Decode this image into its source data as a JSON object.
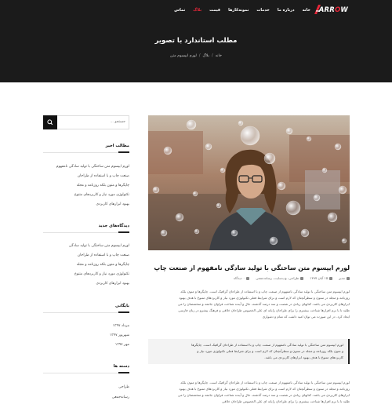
{
  "header": {
    "logo": {
      "main": "ARR",
      "accent": "O",
      "end": "W"
    },
    "nav": [
      {
        "label": "خانه",
        "active": false
      },
      {
        "label": "درباره ما",
        "active": false
      },
      {
        "label": "خدمات",
        "active": false
      },
      {
        "label": "نمونه‌کارها",
        "active": false
      },
      {
        "label": "قیمت",
        "active": false
      },
      {
        "label": "بلاگ",
        "active": true
      },
      {
        "label": "تماس",
        "active": false
      }
    ],
    "page_title": "مطلب استاندارد با تصویر",
    "breadcrumb": [
      "خانه",
      "بلاگ",
      "لورم ایپسوم متن"
    ]
  },
  "sidebar": {
    "search_placeholder": "جستجو ...",
    "recent_posts_title": "مطالب اخیر",
    "recent_posts": [
      "لورم ایپسوم متن ساختگی با تولید سادگی نامفهوم",
      "صنعت چاپ و با استفاده از طراحان",
      "چاپگرها و متون بلکه روزنامه و مجله",
      "تکنولوژی مورد نیاز و کاربردهای متنوع",
      "بهبود ابزارهای کاربردی"
    ],
    "recent_comments_title": "دیدگاه‌های جدید",
    "recent_comments": [
      "لورم ایپسوم متن ساختگی با تولید سادگی",
      "صنعت چاپ و با استفاده از طراحان",
      "چاپگرها و متون بلکه روزنامه و مجله",
      "تکنولوژی مورد نیاز و کاربردهای متنوع",
      "بهبود ابزارهای کاربردی"
    ],
    "archives_title": "بایگانی",
    "archives": [
      "مرداد ۱۳۹۷",
      "شهریور ۱۳۹۷",
      "مهر ۱۳۹۷"
    ],
    "categories_title": "دسته ها",
    "categories": [
      "طراحی",
      "رسانه‌جمعی"
    ]
  },
  "post": {
    "title": "لورم ایپسوم متن ساختگی با تولید سادگی نامفهوم از صنعت چاپ",
    "meta": {
      "author": "مدیر",
      "date": "۱۵ آبان ۱۳۹۷",
      "categories": "طراحی، وب‌سایت، رسانه‌جمعی",
      "comments": "۰ دیدگاه"
    },
    "paragraph1": [
      "لورم ایپسوم متن ساختگی با تولید سادگی نامفهوم از صنعت چاپ و با استفاده از طراحان گرافیک است. چاپگرها و متون بلکه",
      "روزنامه و مجله در ستون و سطرآنچنان که لازم است و برای شرایط فعلی تکنولوژی مورد نیاز و کاربردهای متنوع با هدف بهبود",
      "ابزارهای کاربردی می باشد. کتابهای زیادی در شصت و سه درصد گذشته، حال و آینده شناخت فراوان جامعه و متخصصان را می",
      "طلبد تا با نرم افزارها شناخت بیشتری را برای طراحان رایانه ای علی الخصوص طراحان خلاقی و فرهنگ پیشرو در زبان فارسی",
      "ایجاد کرد. در این صورت می توان امید داشت که تمام و دشواری"
    ],
    "quote": [
      "لورم ایپسوم متن ساختگی با تولید سادگی نامفهوم از صنعت چاپ و با استفاده از طراحان گرافیک است. چاپگرها",
      "و متون بلکه روزنامه و مجله در ستون و سطرآنچنان که لازم است و برای شرایط فعلی تکنولوژی مورد نیاز و",
      "کاربردهای متنوع با هدف بهبود ابزارهای کاربردی می باشد."
    ],
    "paragraph2": [
      "لورم ایپسوم متن ساختگی با تولید سادگی نامفهوم از صنعت چاپ و با استفاده از طراحان گرافیک است. چاپگرها و متون بلکه",
      "روزنامه و مجله در ستون و سطرآنچنان که لازم است و برای شرایط فعلی تکنولوژی مورد نیاز و کاربردهای متنوع با هدف بهبود",
      "ابزارهای کاربردی می باشد. کتابهای زیادی در شصت و سه درصد گذشته، حال و آینده شناخت فراوان جامعه و متخصصان را می",
      "طلبد تا با نرم افزارها شناخت بیشتری را برای طراحان رایانه ای علی الخصوص طراحان خلاقی"
    ]
  },
  "colors": {
    "accent": "#e8273a",
    "hero_bg": "#1b1b1b"
  }
}
